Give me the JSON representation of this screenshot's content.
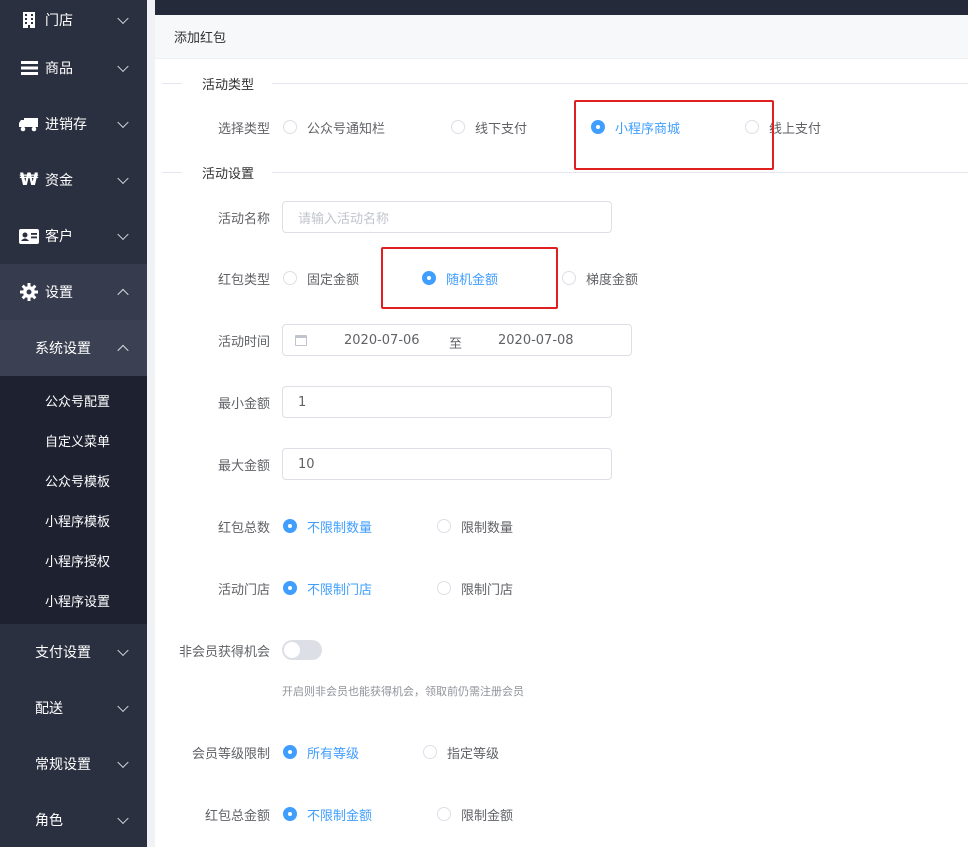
{
  "sidebar": {
    "items": [
      {
        "label": "门店",
        "icon": "building-icon"
      },
      {
        "label": "商品",
        "icon": "list-icon"
      },
      {
        "label": "进销存",
        "icon": "truck-icon"
      },
      {
        "label": "资金",
        "icon": "won-icon"
      },
      {
        "label": "客户",
        "icon": "id-card-icon"
      },
      {
        "label": "设置",
        "icon": "gear-icon"
      }
    ],
    "submenu_title": "系统设置",
    "leaves": [
      "公众号配置",
      "自定义菜单",
      "公众号模板",
      "小程序模板",
      "小程序授权",
      "小程序设置"
    ],
    "more": [
      "支付设置",
      "配送",
      "常规设置",
      "角色"
    ]
  },
  "card": {
    "title": "添加红包"
  },
  "sections": {
    "type": "活动类型",
    "settings": "活动设置"
  },
  "form": {
    "select_type": {
      "label": "选择类型",
      "options": [
        "公众号通知栏",
        "线下支付",
        "小程序商城",
        "线上支付"
      ],
      "selected": "小程序商城"
    },
    "name": {
      "label": "活动名称",
      "placeholder": "请输入活动名称"
    },
    "redpack_type": {
      "label": "红包类型",
      "options": [
        "固定金额",
        "随机金额",
        "梯度金额"
      ],
      "selected": "随机金额"
    },
    "time": {
      "label": "活动时间",
      "start": "2020-07-06",
      "separator": "至",
      "end": "2020-07-08"
    },
    "min_amount": {
      "label": "最小金额",
      "value": "1"
    },
    "max_amount": {
      "label": "最大金额",
      "value": "10"
    },
    "total_count": {
      "label": "红包总数",
      "options": [
        "不限制数量",
        "限制数量"
      ],
      "selected": "不限制数量"
    },
    "store": {
      "label": "活动门店",
      "options": [
        "不限制门店",
        "限制门店"
      ],
      "selected": "不限制门店"
    },
    "non_member": {
      "label": "非会员获得机会",
      "enabled": false,
      "hint": "开启则非会员也能获得机会，领取前仍需注册会员"
    },
    "member_level": {
      "label": "会员等级限制",
      "options": [
        "所有等级",
        "指定等级"
      ],
      "selected": "所有等级"
    },
    "total_amount": {
      "label": "红包总金额",
      "options": [
        "不限制金额",
        "限制金额"
      ],
      "selected": "不限制金额"
    }
  },
  "colors": {
    "sidebar_bg": "#2b3040",
    "accent": "#409eff",
    "highlight": "#e02020"
  }
}
